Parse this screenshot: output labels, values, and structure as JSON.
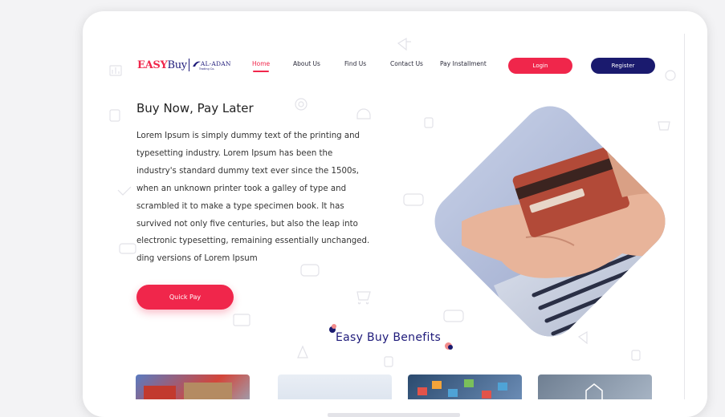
{
  "brand": {
    "easy": "EASY",
    "buy": "Buy",
    "partner": "AL-ADAN",
    "partner_sub": "Trading Co."
  },
  "nav": {
    "items": [
      {
        "label": "Home",
        "active": true
      },
      {
        "label": "About Us",
        "active": false
      },
      {
        "label": "Find Us",
        "active": false
      },
      {
        "label": "Contact Us",
        "active": false
      },
      {
        "label": "Pay Installment",
        "active": false
      }
    ],
    "login": "Login",
    "register": "Register"
  },
  "hero": {
    "title": "Buy Now, Pay Later",
    "lines": [
      "Lorem Ipsum is simply dummy text of the printing and",
      "typesetting industry. Lorem Ipsum has been the",
      "industry's standard dummy text ever since the 1500s,",
      "when an unknown printer took a galley of type and",
      "scrambled it to make a type specimen book. It has",
      "survived not only five centuries, but also the leap into",
      "electronic typesetting, remaining essentially unchanged.",
      "ding versions of Lorem Ipsum"
    ],
    "cta": "Quick Pay"
  },
  "benefits": {
    "title": "Easy Buy Benefits"
  },
  "colors": {
    "primary": "#f0264b",
    "secondary": "#1a1a6e"
  }
}
